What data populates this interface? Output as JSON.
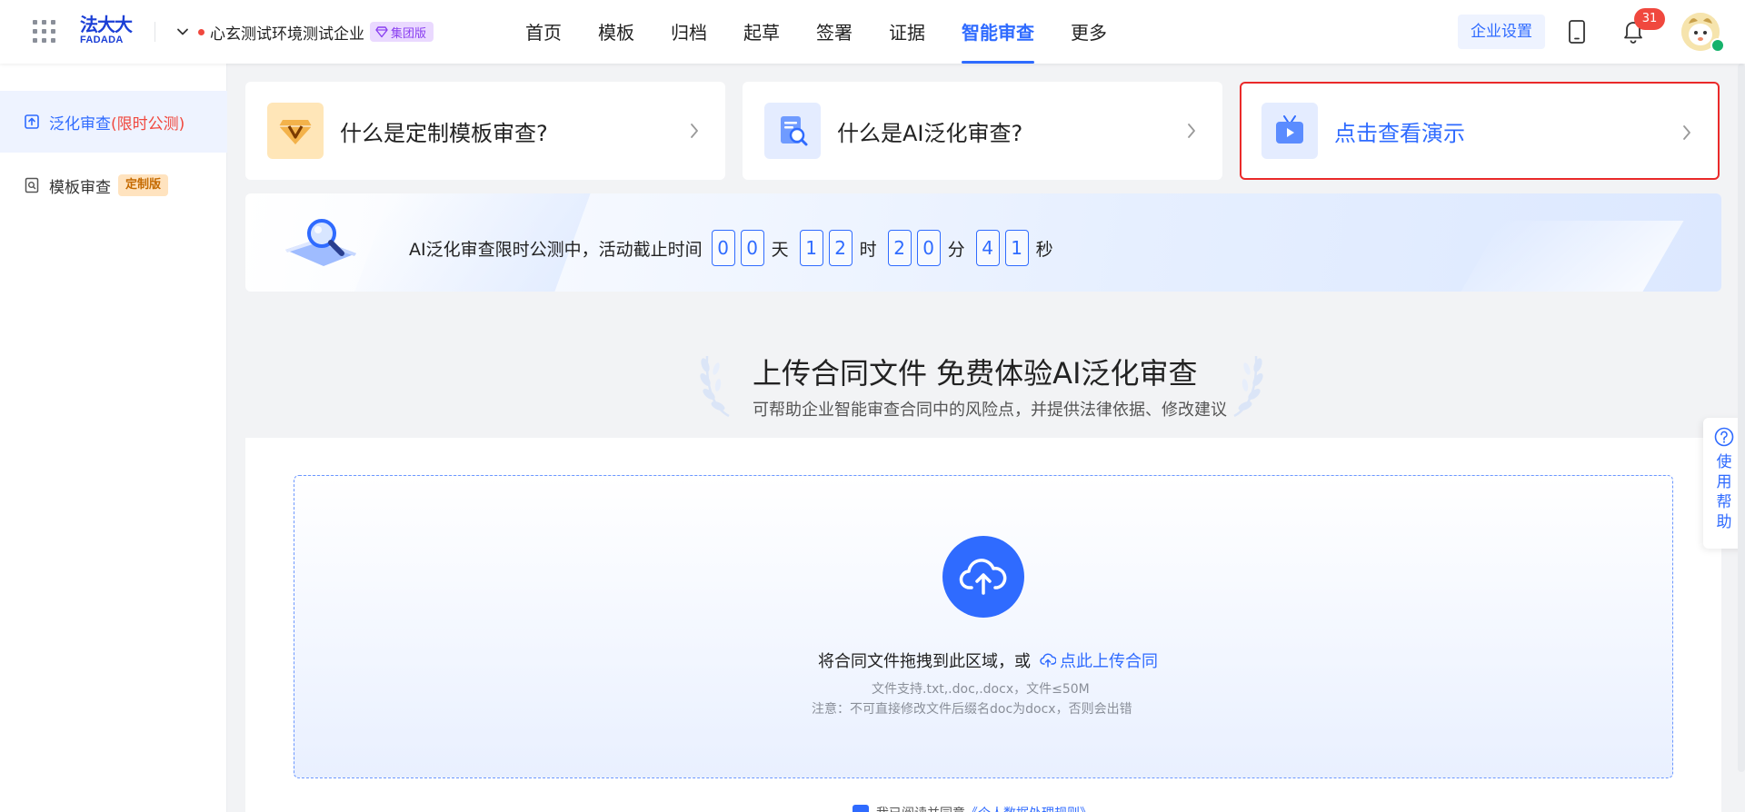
{
  "header": {
    "logo_cn": "法大大",
    "logo_en": "FADADA",
    "company_name": "心玄测试环境测试企业",
    "company_badge": "集团版",
    "nav": [
      {
        "label": "首页"
      },
      {
        "label": "模板"
      },
      {
        "label": "归档"
      },
      {
        "label": "起草"
      },
      {
        "label": "签署"
      },
      {
        "label": "证据"
      },
      {
        "label": "智能审查"
      },
      {
        "label": "更多"
      }
    ],
    "active_nav": "智能审查",
    "settings_label": "企业设置",
    "notification_count": "31"
  },
  "sidebar": {
    "items": [
      {
        "label": "泛化审查",
        "promo": "(限时公测)"
      },
      {
        "label": "模板审查",
        "tag": "定制版"
      }
    ]
  },
  "cards": [
    {
      "title": "什么是定制模板审查?"
    },
    {
      "title": "什么是AI泛化审查?"
    },
    {
      "title": "点击查看演示"
    }
  ],
  "banner": {
    "lead": "AI泛化审查限时公测中，活动截止时间",
    "countdown": {
      "days": [
        "0",
        "0"
      ],
      "hours": [
        "1",
        "2"
      ],
      "minutes": [
        "2",
        "0"
      ],
      "seconds": [
        "4",
        "1"
      ]
    },
    "units": {
      "day": "天",
      "hour": "时",
      "minute": "分",
      "second": "秒"
    }
  },
  "upload": {
    "title": "上传合同文件 免费体验AI泛化审查",
    "subtitle": "可帮助企业智能审查合同中的风险点，并提供法律依据、修改建议",
    "drop_text": "将合同文件拖拽到此区域，或",
    "upload_link": "点此上传合同",
    "hint_formats": "文件支持.txt,.doc,.docx，文件≤50M",
    "hint_note": "注意：不可直接修改文件后缀名doc为docx，否则会出错",
    "agree_text": "我已阅读并同意",
    "agree_link": "《个人数据处理规则》"
  },
  "help": {
    "label": "使用帮助"
  },
  "colors": {
    "primary": "#2f6bff",
    "danger": "#f0483e",
    "group_badge": "#8a3ff0",
    "custom_tag": "#c56a00"
  }
}
